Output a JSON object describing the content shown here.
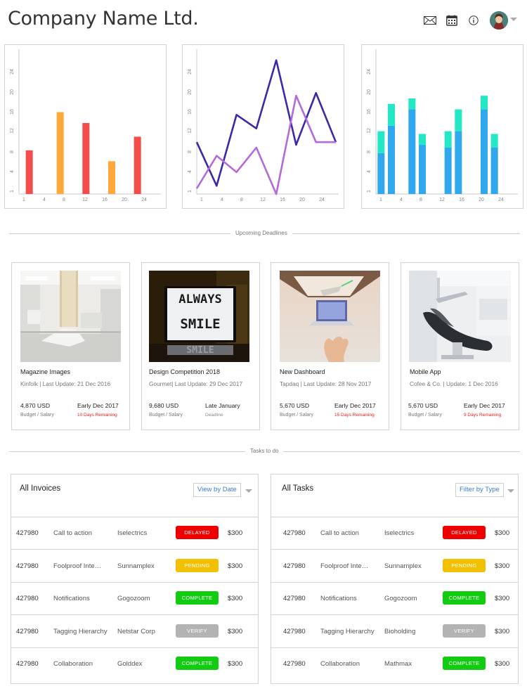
{
  "header": {
    "title": "Company Name Ltd.",
    "icons": [
      "mail-icon",
      "calendar-icon",
      "info-icon"
    ]
  },
  "charts": {
    "colors": {
      "red": "#f44b4b",
      "orange": "#ffa93a",
      "purple_dark": "#3a2aa8",
      "purple_light": "#b46ad8",
      "blue": "#2fa8ee",
      "teal": "#22e8c6"
    },
    "y_ticks": [
      "1",
      "4",
      "8",
      "12",
      "16",
      "20",
      "24"
    ],
    "x_ticks": [
      "1",
      "4",
      "8",
      "12",
      "16",
      "20",
      "24"
    ]
  },
  "chart_data": [
    {
      "type": "bar",
      "x": [
        2,
        8,
        13,
        18,
        23
      ],
      "values": [
        8,
        15,
        13,
        6,
        10.5
      ],
      "colors": [
        "#f44b4b",
        "#ffa93a",
        "#f44b4b",
        "#ffa93a",
        "#f44b4b"
      ],
      "xlim": [
        0,
        27
      ],
      "ylim": [
        0,
        26
      ],
      "grid": false
    },
    {
      "type": "line",
      "series": [
        {
          "x": [
            0,
            5,
            10,
            15,
            20,
            25,
            30,
            35
          ],
          "values": [
            9.5,
            1.5,
            14.5,
            12,
            24.5,
            9,
            18.5,
            9.5
          ],
          "color": "#3a2aa8"
        },
        {
          "x": [
            0,
            5,
            10,
            15,
            20,
            25,
            30,
            35
          ],
          "values": [
            1,
            7,
            4,
            8.5,
            0,
            18,
            9.5,
            9.5
          ],
          "color": "#b46ad8"
        }
      ],
      "xlim": [
        0,
        35
      ],
      "ylim": [
        0,
        26
      ],
      "grid": false
    },
    {
      "type": "bar",
      "stacked": true,
      "x": [
        1,
        3,
        7,
        9,
        14,
        16,
        21,
        23
      ],
      "series": [
        {
          "values": [
            7.5,
            12.5,
            15.5,
            9,
            8.5,
            11.5,
            15.5,
            8.5
          ],
          "color": "#2fa8ee"
        },
        {
          "values": [
            4,
            4,
            2,
            2,
            3,
            4,
            2.5,
            2.5
          ],
          "color": "#22e8c6"
        }
      ],
      "xlim": [
        0,
        27
      ],
      "ylim": [
        0,
        26
      ],
      "grid": false
    }
  ],
  "sections": {
    "deadlines_label": "Upcoming Deadlines",
    "tasks_label": "Tasks to do"
  },
  "projects": [
    {
      "name": "Magazine Images",
      "sub": "Kinfolk | Last Update: 21 Dec 2016",
      "budget": "4,870 USD",
      "budget_label": "Budget / Salary",
      "date": "Early Dec 2017",
      "remaining": "10 Days Remaining",
      "remaining_color": "#e82020"
    },
    {
      "name": "Design Competition 2018",
      "sub": "Gourmet| Last Update: 29 Dec 2017",
      "budget": "9,680 USD",
      "budget_label": "Budget / Salary",
      "date": "Late January",
      "remaining": "Deadline",
      "remaining_color": "#888888"
    },
    {
      "name": "New Dashboard",
      "sub": "Tapdaq | Last Update: 28 Nov 2017",
      "budget": "5,670 USD",
      "budget_label": "Budget / Salary",
      "date": "Early Dec 2017",
      "remaining": "15 Days Remaining",
      "remaining_color": "#e82020"
    },
    {
      "name": "Mobile App",
      "sub": "Cofee & Co. | Update: 1 Dec 2016",
      "budget": "5,670 USD",
      "budget_label": "Budget / Salary",
      "date": "Early Dec 2017",
      "remaining": "9 Days Remaining",
      "remaining_color": "#e82020"
    }
  ],
  "invoices": {
    "title": "All Invoices",
    "filter": "View by Date",
    "rows": [
      {
        "id": "427980",
        "task": "Call to action",
        "company": "Iselectrics",
        "status": "DELAYED",
        "status_color": "#ee0000",
        "amount": "$300"
      },
      {
        "id": "427980",
        "task": "Foolproof Inte…",
        "company": "Sunnamplex",
        "status": "PENDING",
        "status_color": "#f2c000",
        "amount": "$300"
      },
      {
        "id": "427980",
        "task": "Notifications",
        "company": "Gogozoom",
        "status": "COMPLETE",
        "status_color": "#11cc11",
        "amount": "$300"
      },
      {
        "id": "427980",
        "task": "Tagging Hierarchy",
        "company": "Netstar Corp",
        "status": "VERIFY",
        "status_color": "#b3b3b3",
        "amount": "$300"
      },
      {
        "id": "427980",
        "task": "Collaboration",
        "company": "Golddex",
        "status": "COMPLETE",
        "status_color": "#11cc11",
        "amount": "$300"
      }
    ]
  },
  "tasks": {
    "title": "All Tasks",
    "filter": "Filter by Type",
    "rows": [
      {
        "id": "427980",
        "task": "Call to action",
        "company": "Iselectrics",
        "status": "DELAYED",
        "status_color": "#ee0000",
        "amount": "$300"
      },
      {
        "id": "427980",
        "task": "Foolproof Inte…",
        "company": "Sunnamplex",
        "status": "PENDING",
        "status_color": "#f2c000",
        "amount": "$300"
      },
      {
        "id": "427980",
        "task": "Notifications",
        "company": "Gogozoom",
        "status": "COMPLETE",
        "status_color": "#11cc11",
        "amount": "$300"
      },
      {
        "id": "427980",
        "task": "Tagging Hierarchy",
        "company": "Bioholding",
        "status": "VERIFY",
        "status_color": "#b3b3b3",
        "amount": "$300"
      },
      {
        "id": "427980",
        "task": "Collaboration",
        "company": "Mathmax",
        "status": "COMPLETE",
        "status_color": "#11cc11",
        "amount": "$300"
      }
    ]
  }
}
